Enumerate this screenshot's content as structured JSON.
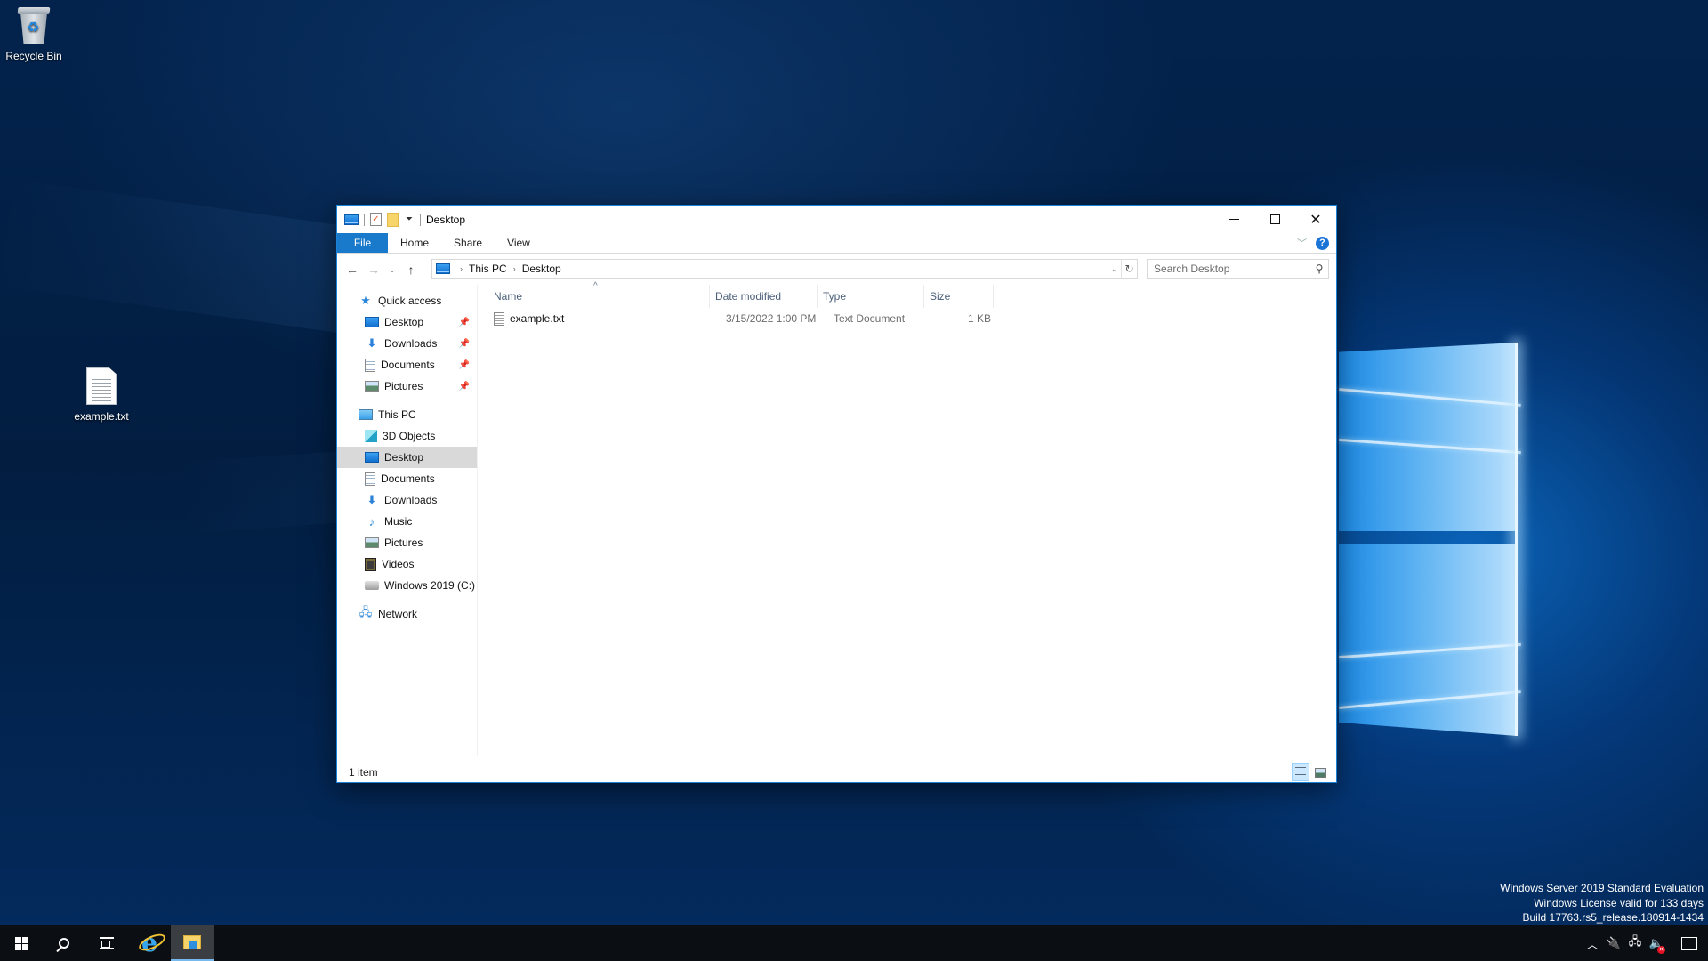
{
  "desktop": {
    "icons": [
      {
        "label": "Recycle Bin",
        "icon": "recycle-bin-icon"
      },
      {
        "label": "example.txt",
        "icon": "text-file-icon"
      }
    ],
    "watermark": [
      "Windows Server 2019 Standard Evaluation",
      "Windows License valid for 133 days",
      "Build 17763.rs5_release.180914-1434"
    ]
  },
  "explorer": {
    "title": "Desktop",
    "quick_access_toolbar": [
      "this-pc-icon",
      "properties-icon",
      "new-folder-icon",
      "customize-dropdown-icon"
    ],
    "window_controls": {
      "minimize": "minimize",
      "maximize": "maximize",
      "close": "✕"
    },
    "ribbon_tabs": [
      {
        "label": "File",
        "active": true
      },
      {
        "label": "Home"
      },
      {
        "label": "Share"
      },
      {
        "label": "View"
      }
    ],
    "help_label": "?",
    "nav": {
      "back": "←",
      "forward": "→",
      "recent": "⌄",
      "up": "↑"
    },
    "address": {
      "crumbs": [
        "This PC",
        "Desktop"
      ],
      "separator": "›",
      "refresh": "↻"
    },
    "search": {
      "placeholder": "Search Desktop",
      "value": ""
    },
    "navpane": {
      "quick_access": {
        "label": "Quick access",
        "items": [
          {
            "label": "Desktop",
            "pinned": true
          },
          {
            "label": "Downloads",
            "pinned": true
          },
          {
            "label": "Documents",
            "pinned": true
          },
          {
            "label": "Pictures",
            "pinned": true
          }
        ]
      },
      "this_pc": {
        "label": "This PC",
        "items": [
          {
            "label": "3D Objects"
          },
          {
            "label": "Desktop",
            "selected": true
          },
          {
            "label": "Documents"
          },
          {
            "label": "Downloads"
          },
          {
            "label": "Music"
          },
          {
            "label": "Pictures"
          },
          {
            "label": "Videos"
          },
          {
            "label": "Windows 2019 (C:)"
          }
        ]
      },
      "network": {
        "label": "Network"
      }
    },
    "columns": [
      {
        "label": "Name",
        "sorted": "ascending"
      },
      {
        "label": "Date modified"
      },
      {
        "label": "Type"
      },
      {
        "label": "Size"
      }
    ],
    "files": [
      {
        "name": "example.txt",
        "date_modified": "3/15/2022 1:00 PM",
        "type": "Text Document",
        "size": "1 KB"
      }
    ],
    "status": "1 item",
    "view_modes": [
      {
        "name": "details",
        "active": true
      },
      {
        "name": "large-icons",
        "active": false
      }
    ]
  },
  "taskbar": {
    "buttons": [
      "start",
      "search",
      "task-view",
      "internet-explorer",
      "file-explorer"
    ],
    "active": "file-explorer",
    "tray": [
      "show-hidden-icons",
      "power",
      "network",
      "volume-muted",
      "action-center"
    ]
  },
  "colors": {
    "accent": "#1979ca",
    "window_border": "#1883d7",
    "taskbar": "#0b0f14",
    "selection": "#d9d9d9"
  }
}
